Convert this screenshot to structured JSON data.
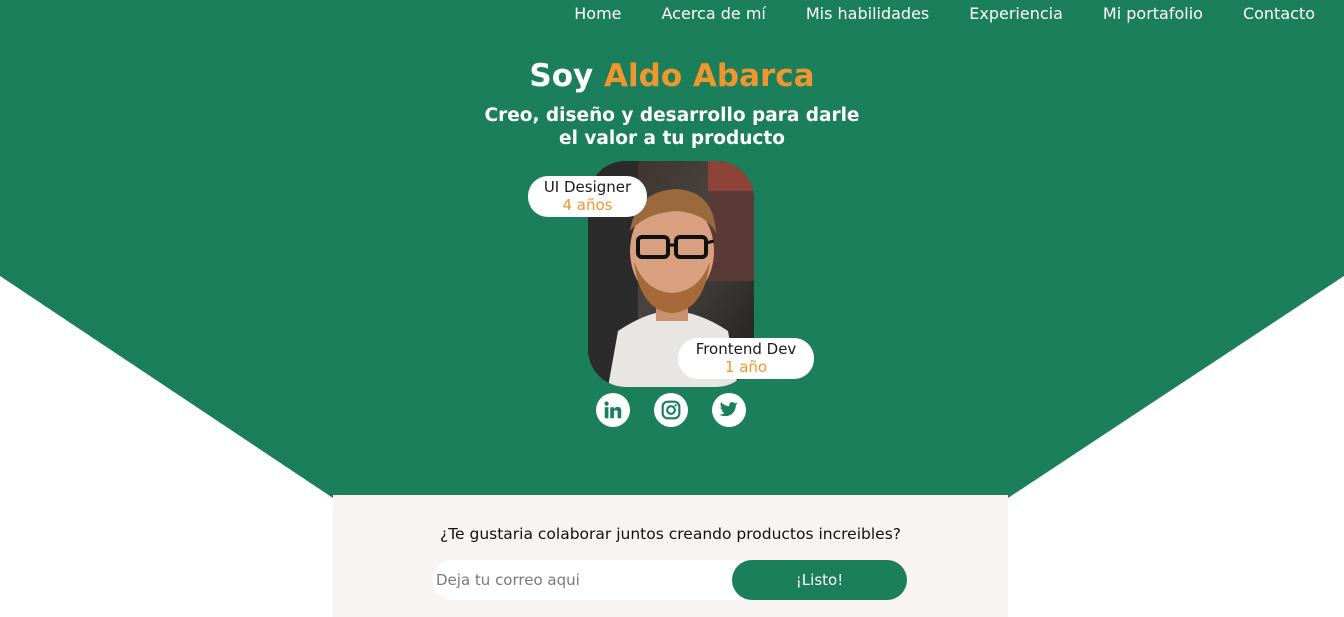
{
  "colors": {
    "brand_green": "#1a7f5a",
    "accent_orange": "#f0962e",
    "panel_bg": "#f8f4f1"
  },
  "nav": {
    "items": [
      "Home",
      "Acerca de mí",
      "Mis habilidades",
      "Experiencia",
      "Mi portafolio",
      "Contacto"
    ]
  },
  "hero": {
    "title_prefix": "Soy",
    "title_name": "Aldo Abarca",
    "subtitle": "Creo, diseño y desarrollo para darle el valor a tu producto",
    "badges": [
      {
        "role": "UI Designer",
        "years": "4 años"
      },
      {
        "role": "Frontend Dev",
        "years": "1 año"
      }
    ],
    "socials": [
      "linkedin-icon",
      "instagram-icon",
      "twitter-icon"
    ]
  },
  "collab": {
    "question": "¿Te gustaria colaborar juntos creando productos increibles?",
    "email_placeholder": "Deja tu correo aqui",
    "email_value": "",
    "button_label": "¡Listo!"
  }
}
